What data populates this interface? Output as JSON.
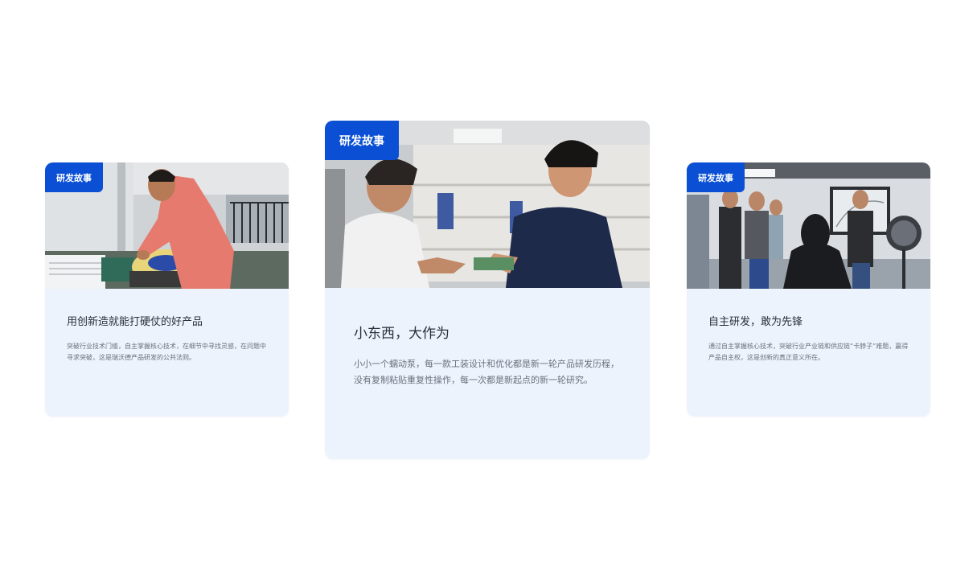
{
  "cards": [
    {
      "tag": "研发故事",
      "title": "用创新造就能打硬仗的好产品",
      "description": "突破行业技术门槛，自主掌握核心技术，在细节中寻找灵感，在问题中寻求突破，这是瑞沃德产品研发的公共法则。"
    },
    {
      "tag": "研发故事",
      "title": "小东西，大作为",
      "description": "小小一个蠕动泵，每一款工装设计和优化都是新一轮产品研发历程，没有复制粘贴重复性操作，每一次都是新起点的新一轮研究。"
    },
    {
      "tag": "研发故事",
      "title": "自主研发，敢为先锋",
      "description": "通过自主掌握核心技术，突破行业产业链和供应链“卡脖子”难题，赢得产品自主权，这是创新的真正意义所在。"
    }
  ],
  "colors": {
    "accent": "#0a4fd4",
    "card_background": "#edf3fd",
    "title_text": "#2a2f38",
    "body_text": "#6a717c"
  }
}
